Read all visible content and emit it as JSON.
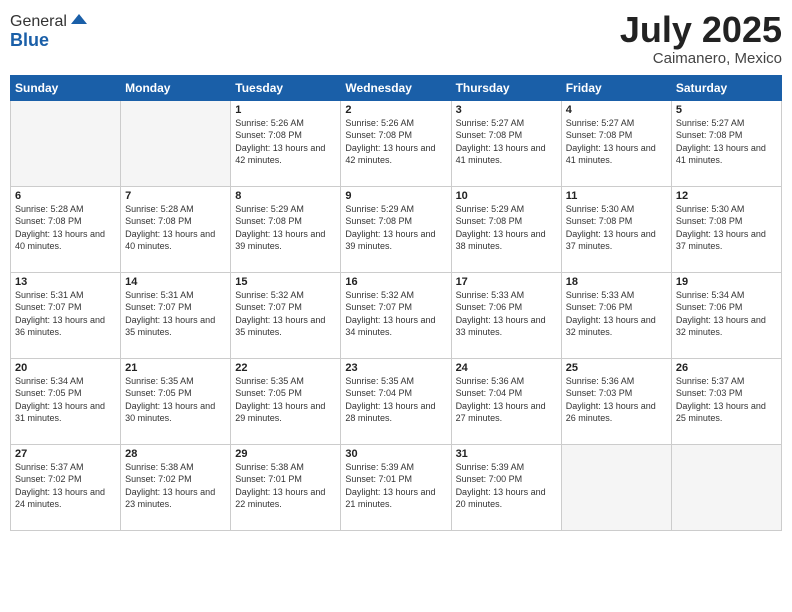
{
  "header": {
    "logo_general": "General",
    "logo_blue": "Blue",
    "month": "July 2025",
    "location": "Caimanero, Mexico"
  },
  "weekdays": [
    "Sunday",
    "Monday",
    "Tuesday",
    "Wednesday",
    "Thursday",
    "Friday",
    "Saturday"
  ],
  "weeks": [
    [
      {
        "day": "",
        "empty": true
      },
      {
        "day": "",
        "empty": true
      },
      {
        "day": "1",
        "sunrise": "Sunrise: 5:26 AM",
        "sunset": "Sunset: 7:08 PM",
        "daylight": "Daylight: 13 hours and 42 minutes."
      },
      {
        "day": "2",
        "sunrise": "Sunrise: 5:26 AM",
        "sunset": "Sunset: 7:08 PM",
        "daylight": "Daylight: 13 hours and 42 minutes."
      },
      {
        "day": "3",
        "sunrise": "Sunrise: 5:27 AM",
        "sunset": "Sunset: 7:08 PM",
        "daylight": "Daylight: 13 hours and 41 minutes."
      },
      {
        "day": "4",
        "sunrise": "Sunrise: 5:27 AM",
        "sunset": "Sunset: 7:08 PM",
        "daylight": "Daylight: 13 hours and 41 minutes."
      },
      {
        "day": "5",
        "sunrise": "Sunrise: 5:27 AM",
        "sunset": "Sunset: 7:08 PM",
        "daylight": "Daylight: 13 hours and 41 minutes."
      }
    ],
    [
      {
        "day": "6",
        "sunrise": "Sunrise: 5:28 AM",
        "sunset": "Sunset: 7:08 PM",
        "daylight": "Daylight: 13 hours and 40 minutes."
      },
      {
        "day": "7",
        "sunrise": "Sunrise: 5:28 AM",
        "sunset": "Sunset: 7:08 PM",
        "daylight": "Daylight: 13 hours and 40 minutes."
      },
      {
        "day": "8",
        "sunrise": "Sunrise: 5:29 AM",
        "sunset": "Sunset: 7:08 PM",
        "daylight": "Daylight: 13 hours and 39 minutes."
      },
      {
        "day": "9",
        "sunrise": "Sunrise: 5:29 AM",
        "sunset": "Sunset: 7:08 PM",
        "daylight": "Daylight: 13 hours and 39 minutes."
      },
      {
        "day": "10",
        "sunrise": "Sunrise: 5:29 AM",
        "sunset": "Sunset: 7:08 PM",
        "daylight": "Daylight: 13 hours and 38 minutes."
      },
      {
        "day": "11",
        "sunrise": "Sunrise: 5:30 AM",
        "sunset": "Sunset: 7:08 PM",
        "daylight": "Daylight: 13 hours and 37 minutes."
      },
      {
        "day": "12",
        "sunrise": "Sunrise: 5:30 AM",
        "sunset": "Sunset: 7:08 PM",
        "daylight": "Daylight: 13 hours and 37 minutes."
      }
    ],
    [
      {
        "day": "13",
        "sunrise": "Sunrise: 5:31 AM",
        "sunset": "Sunset: 7:07 PM",
        "daylight": "Daylight: 13 hours and 36 minutes."
      },
      {
        "day": "14",
        "sunrise": "Sunrise: 5:31 AM",
        "sunset": "Sunset: 7:07 PM",
        "daylight": "Daylight: 13 hours and 35 minutes."
      },
      {
        "day": "15",
        "sunrise": "Sunrise: 5:32 AM",
        "sunset": "Sunset: 7:07 PM",
        "daylight": "Daylight: 13 hours and 35 minutes."
      },
      {
        "day": "16",
        "sunrise": "Sunrise: 5:32 AM",
        "sunset": "Sunset: 7:07 PM",
        "daylight": "Daylight: 13 hours and 34 minutes."
      },
      {
        "day": "17",
        "sunrise": "Sunrise: 5:33 AM",
        "sunset": "Sunset: 7:06 PM",
        "daylight": "Daylight: 13 hours and 33 minutes."
      },
      {
        "day": "18",
        "sunrise": "Sunrise: 5:33 AM",
        "sunset": "Sunset: 7:06 PM",
        "daylight": "Daylight: 13 hours and 32 minutes."
      },
      {
        "day": "19",
        "sunrise": "Sunrise: 5:34 AM",
        "sunset": "Sunset: 7:06 PM",
        "daylight": "Daylight: 13 hours and 32 minutes."
      }
    ],
    [
      {
        "day": "20",
        "sunrise": "Sunrise: 5:34 AM",
        "sunset": "Sunset: 7:05 PM",
        "daylight": "Daylight: 13 hours and 31 minutes."
      },
      {
        "day": "21",
        "sunrise": "Sunrise: 5:35 AM",
        "sunset": "Sunset: 7:05 PM",
        "daylight": "Daylight: 13 hours and 30 minutes."
      },
      {
        "day": "22",
        "sunrise": "Sunrise: 5:35 AM",
        "sunset": "Sunset: 7:05 PM",
        "daylight": "Daylight: 13 hours and 29 minutes."
      },
      {
        "day": "23",
        "sunrise": "Sunrise: 5:35 AM",
        "sunset": "Sunset: 7:04 PM",
        "daylight": "Daylight: 13 hours and 28 minutes."
      },
      {
        "day": "24",
        "sunrise": "Sunrise: 5:36 AM",
        "sunset": "Sunset: 7:04 PM",
        "daylight": "Daylight: 13 hours and 27 minutes."
      },
      {
        "day": "25",
        "sunrise": "Sunrise: 5:36 AM",
        "sunset": "Sunset: 7:03 PM",
        "daylight": "Daylight: 13 hours and 26 minutes."
      },
      {
        "day": "26",
        "sunrise": "Sunrise: 5:37 AM",
        "sunset": "Sunset: 7:03 PM",
        "daylight": "Daylight: 13 hours and 25 minutes."
      }
    ],
    [
      {
        "day": "27",
        "sunrise": "Sunrise: 5:37 AM",
        "sunset": "Sunset: 7:02 PM",
        "daylight": "Daylight: 13 hours and 24 minutes."
      },
      {
        "day": "28",
        "sunrise": "Sunrise: 5:38 AM",
        "sunset": "Sunset: 7:02 PM",
        "daylight": "Daylight: 13 hours and 23 minutes."
      },
      {
        "day": "29",
        "sunrise": "Sunrise: 5:38 AM",
        "sunset": "Sunset: 7:01 PM",
        "daylight": "Daylight: 13 hours and 22 minutes."
      },
      {
        "day": "30",
        "sunrise": "Sunrise: 5:39 AM",
        "sunset": "Sunset: 7:01 PM",
        "daylight": "Daylight: 13 hours and 21 minutes."
      },
      {
        "day": "31",
        "sunrise": "Sunrise: 5:39 AM",
        "sunset": "Sunset: 7:00 PM",
        "daylight": "Daylight: 13 hours and 20 minutes."
      },
      {
        "day": "",
        "empty": true
      },
      {
        "day": "",
        "empty": true
      }
    ]
  ]
}
